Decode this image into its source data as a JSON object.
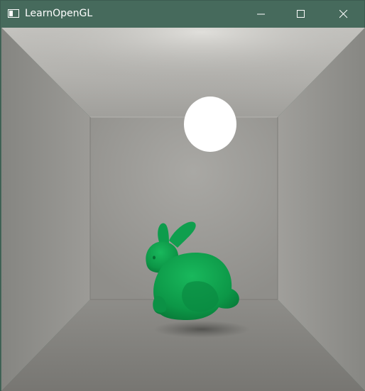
{
  "window": {
    "title": "LearnOpenGL",
    "controls": {
      "minimize_icon": "minimize-icon",
      "maximize_icon": "maximize-icon",
      "close_icon": "close-icon"
    }
  },
  "scene": {
    "description_colors": {
      "wall": "#8e8e8b",
      "light": "#ffffff",
      "bunny": "#0d9c4c"
    }
  }
}
